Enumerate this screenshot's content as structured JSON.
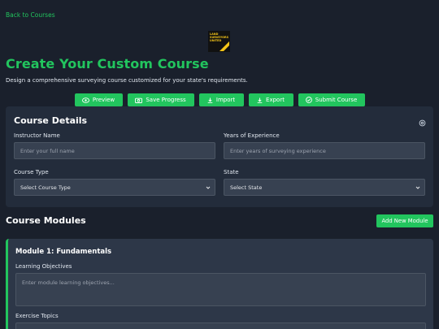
{
  "nav": {
    "back_label": "Back to Courses"
  },
  "logo": {
    "line1": "LAND",
    "line2": "SURVEYORS",
    "line3": "UNITED"
  },
  "header": {
    "title": "Create Your Custom Course",
    "subtitle": "Design a comprehensive surveying course customized for your state's requirements."
  },
  "actions": {
    "preview": "Preview",
    "save": "Save Progress",
    "import": "Import",
    "export": "Export",
    "submit": "Submit Course"
  },
  "course_details": {
    "title": "Course Details",
    "instructor_label": "Instructor Name",
    "instructor_placeholder": "Enter your full name",
    "experience_label": "Years of Experience",
    "experience_placeholder": "Enter years of surveying experience",
    "course_type_label": "Course Type",
    "course_type_value": "Select Course Type",
    "state_label": "State",
    "state_value": "Select State"
  },
  "modules": {
    "title": "Course Modules",
    "add_label": "Add New Module",
    "items": [
      {
        "title": "Module 1: Fundamentals",
        "objectives_label": "Learning Objectives",
        "objectives_placeholder": "Enter module learning objectives...",
        "topics_label": "Exercise Topics"
      }
    ]
  },
  "colors": {
    "accent": "#22c55e",
    "background": "#1a202c",
    "card": "#232c3b",
    "input": "#374151"
  },
  "icons": {
    "preview": "eye-icon",
    "save": "camera-icon",
    "import": "download-icon",
    "export": "download-icon",
    "submit": "check-circle-icon",
    "settings": "gear-icon"
  }
}
